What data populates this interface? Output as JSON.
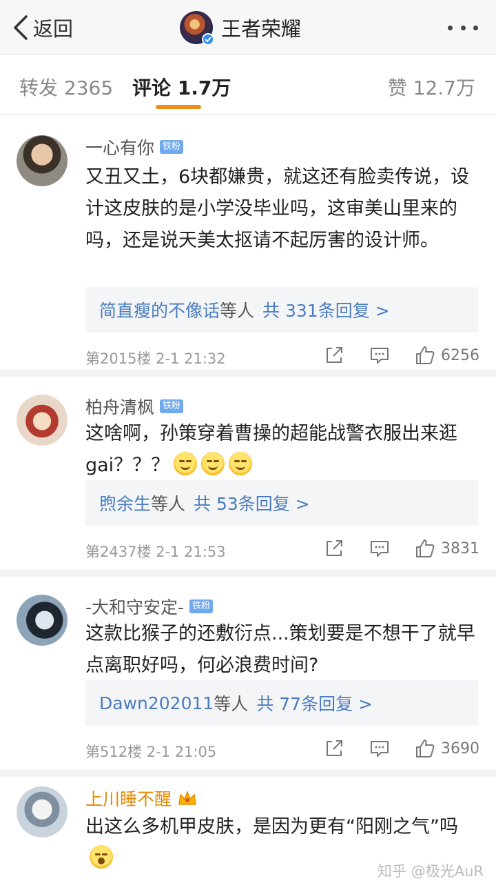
{
  "header": {
    "back_label": "返回",
    "title": "王者荣耀",
    "avatar_icon": "game-logo-avatar",
    "verified_icon": "verified-icon",
    "more_icon": "more-dots-icon"
  },
  "tabs": [
    {
      "label": "转发 2365",
      "active": false
    },
    {
      "label": "评论 1.7万",
      "active": true
    },
    {
      "label": "赞 12.7万",
      "active": false
    }
  ],
  "accent_color": "#f08c1c",
  "link_color": "#4a7cbf",
  "comments": [
    {
      "name": "一心有你",
      "badge": "铁粉",
      "text": "又丑又土，6块都嫌贵，就这还有脸卖传说，设计这皮肤的是小学没毕业吗，这审美山里来的吗，还是说天美太抠请不起厉害的设计师。",
      "reply_names": "简直瘦的不像话",
      "reply_mid": "等人",
      "reply_total": "共 331条回复 >",
      "meta": "第2015楼  2-1 21:32",
      "likes": "6256"
    },
    {
      "name": "柏舟清枫",
      "badge": "铁粉",
      "text": "这啥啊，孙策穿着曹操的超能战警衣服出来逛gai？？？",
      "reply_names": "煦余生",
      "reply_mid": "等人",
      "reply_total": "共 53条回复 >",
      "meta": "第2437楼  2-1 21:53",
      "likes": "3831"
    },
    {
      "name": "-大和守安定-",
      "badge": "铁粉",
      "text": "这款比猴子的还敷衍点...策划要是不想干了就早点离职好吗，何必浪费时间?",
      "reply_names": "Dawn202011",
      "reply_mid": "等人",
      "reply_total": "共 77条回复 >",
      "meta": "第512楼  2-1 21:05",
      "likes": "3690"
    },
    {
      "name": "上川睡不醒",
      "text": "出这么多机甲皮肤，是因为更有“阳刚之气”吗"
    }
  ],
  "watermark": "知乎 @极光AuR"
}
